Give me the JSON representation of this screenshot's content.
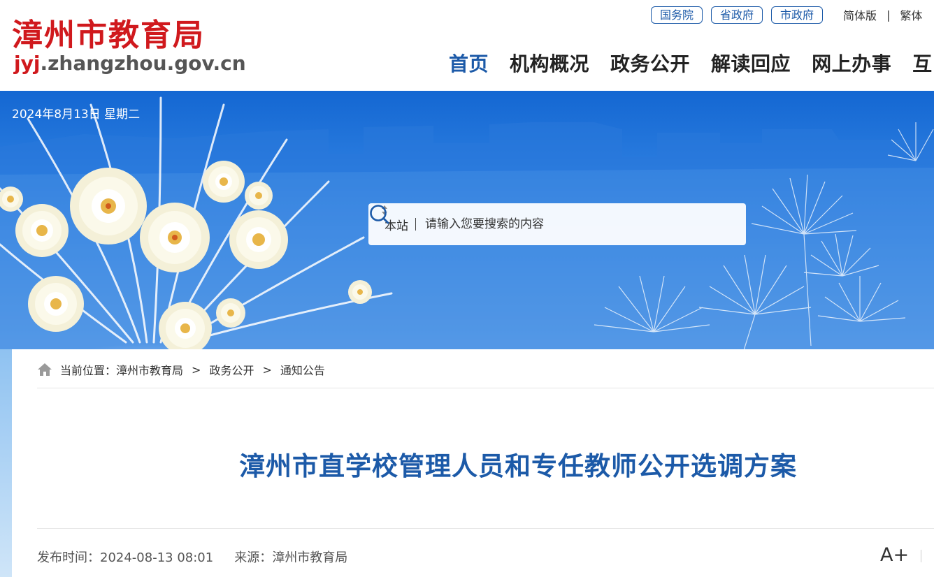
{
  "site": {
    "name": "漳州市教育局",
    "url_prefix": "jyj",
    "url_rest": ".zhangzhou.gov.cn"
  },
  "top_links": [
    "国务院",
    "省政府",
    "市政府"
  ],
  "lang": {
    "simplified": "简体版",
    "separator": "|",
    "traditional": "繁体"
  },
  "nav": [
    "首页",
    "机构概况",
    "政务公开",
    "解读回应",
    "网上办事",
    "互"
  ],
  "banner": {
    "date": "2024年8月13日 星期二"
  },
  "search": {
    "scope": "本站",
    "placeholder": "请输入您要搜索的内容"
  },
  "breadcrumb": {
    "prefix": "当前位置：",
    "items": [
      "漳州市教育局",
      "政务公开",
      "通知公告"
    ],
    "separator": ">"
  },
  "article": {
    "title": "漳州市直学校管理人员和专任教师公开选调方案",
    "publish_label": "发布时间：",
    "publish_time": "2024-08-13 08:01",
    "source_label": "来源：",
    "source": "漳州市教育局",
    "font_increase": "A+"
  },
  "colors": {
    "brand_red": "#d0191d",
    "brand_blue": "#1c5aa8",
    "banner_blue": "#1467d2"
  },
  "icons": {
    "home": "home-icon",
    "search": "search-icon",
    "sort": "sort-arrows-icon"
  }
}
